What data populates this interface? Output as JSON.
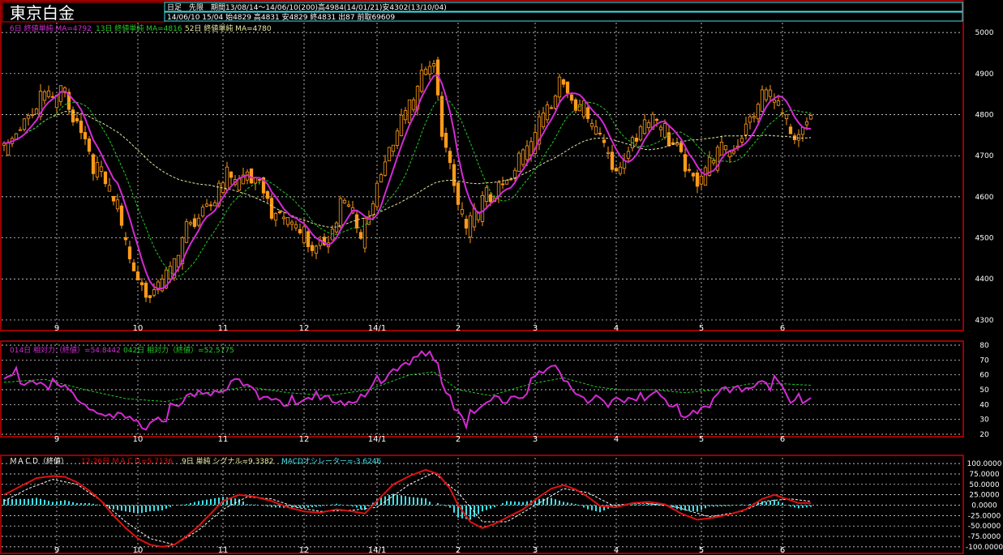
{
  "header": {
    "title": "東京白金",
    "line1": "日足　先限　期間13/08/14～14/06/10(200)高4984(14/01/21)安4302(13/10/04)",
    "line2": "14/06/10 15/04 始4829 高4831 安4829 終4831 出87 前取69609"
  },
  "colors": {
    "up": "#ff9a1a",
    "down": "#ff9a1a",
    "ma6": "#d42ad4",
    "ma13": "#22cc22",
    "ma52": "#e8e8a0",
    "macd": "#e01010",
    "signal": "#ffffff",
    "hist": "#40e0e8",
    "grid": "#ffffff",
    "frame": "#cc0000"
  },
  "chart_data": [
    {
      "type": "candlestick",
      "legend": {
        "ma6": "6日 終値単純 MA=4792",
        "ma13": "13日 終値単純 MA=4816",
        "ma52": "52日 終値単純 MA=4780"
      },
      "yticks": [
        4300,
        4400,
        4500,
        4600,
        4700,
        4800,
        4900,
        5000
      ],
      "ylim": [
        4290,
        5020
      ],
      "xtick_labels": [
        {
          "label": "9",
          "index": 13
        },
        {
          "label": "10",
          "index": 33
        },
        {
          "label": "11",
          "index": 54
        },
        {
          "label": "12",
          "index": 74
        },
        {
          "label": "14/1",
          "index": 92
        },
        {
          "label": "2",
          "index": 112
        },
        {
          "label": "3",
          "index": 131
        },
        {
          "label": "4",
          "index": 151
        },
        {
          "label": "5",
          "index": 172
        },
        {
          "label": "6",
          "index": 192
        }
      ],
      "anchors": [
        [
          0,
          4740
        ],
        [
          4,
          4800
        ],
        [
          7,
          4830
        ],
        [
          10,
          4870
        ],
        [
          12,
          4840
        ],
        [
          15,
          4870
        ],
        [
          17,
          4820
        ],
        [
          20,
          4760
        ],
        [
          22,
          4700
        ],
        [
          25,
          4640
        ],
        [
          28,
          4580
        ],
        [
          30,
          4500
        ],
        [
          33,
          4430
        ],
        [
          36,
          4380
        ],
        [
          38,
          4400
        ],
        [
          41,
          4420
        ],
        [
          43,
          4470
        ],
        [
          46,
          4560
        ],
        [
          49,
          4590
        ],
        [
          52,
          4620
        ],
        [
          55,
          4660
        ],
        [
          58,
          4640
        ],
        [
          61,
          4670
        ],
        [
          64,
          4650
        ],
        [
          66,
          4590
        ],
        [
          68,
          4560
        ],
        [
          71,
          4540
        ],
        [
          74,
          4520
        ],
        [
          77,
          4500
        ],
        [
          80,
          4530
        ],
        [
          83,
          4590
        ],
        [
          86,
          4570
        ],
        [
          88,
          4500
        ],
        [
          90,
          4590
        ],
        [
          92,
          4650
        ],
        [
          95,
          4740
        ],
        [
          98,
          4800
        ],
        [
          101,
          4850
        ],
        [
          104,
          4920
        ],
        [
          106,
          4950
        ],
        [
          108,
          4790
        ],
        [
          110,
          4700
        ],
        [
          112,
          4610
        ],
        [
          114,
          4520
        ],
        [
          116,
          4560
        ],
        [
          119,
          4610
        ],
        [
          122,
          4650
        ],
        [
          125,
          4670
        ],
        [
          128,
          4720
        ],
        [
          131,
          4760
        ],
        [
          134,
          4830
        ],
        [
          137,
          4920
        ],
        [
          140,
          4870
        ],
        [
          143,
          4820
        ],
        [
          146,
          4770
        ],
        [
          149,
          4720
        ],
        [
          151,
          4680
        ],
        [
          154,
          4750
        ],
        [
          157,
          4780
        ],
        [
          160,
          4800
        ],
        [
          163,
          4770
        ],
        [
          166,
          4750
        ],
        [
          169,
          4680
        ],
        [
          172,
          4660
        ],
        [
          175,
          4700
        ],
        [
          178,
          4730
        ],
        [
          181,
          4760
        ],
        [
          184,
          4820
        ],
        [
          187,
          4860
        ],
        [
          190,
          4850
        ],
        [
          192,
          4800
        ],
        [
          195,
          4760
        ],
        [
          197,
          4790
        ],
        [
          199,
          4831
        ]
      ],
      "count": 200
    },
    {
      "type": "line",
      "legend": {
        "rsi14": "014日 相対力（終値）=54.8442",
        "rsi42": "042日 相対力（終値）=52.5775"
      },
      "yticks": [
        20,
        30,
        40,
        50,
        60,
        70,
        80
      ],
      "ylim": [
        20,
        80
      ],
      "anchors": [
        [
          0,
          60
        ],
        [
          3,
          63
        ],
        [
          6,
          60
        ],
        [
          9,
          58
        ],
        [
          12,
          55
        ],
        [
          15,
          52
        ],
        [
          18,
          46
        ],
        [
          21,
          42
        ],
        [
          24,
          38
        ],
        [
          27,
          33
        ],
        [
          30,
          30
        ],
        [
          33,
          28
        ],
        [
          36,
          32
        ],
        [
          39,
          36
        ],
        [
          42,
          40
        ],
        [
          45,
          44
        ],
        [
          48,
          50
        ],
        [
          52,
          54
        ],
        [
          56,
          57
        ],
        [
          60,
          55
        ],
        [
          64,
          50
        ],
        [
          68,
          46
        ],
        [
          72,
          43
        ],
        [
          76,
          45
        ],
        [
          80,
          50
        ],
        [
          84,
          47
        ],
        [
          87,
          42
        ],
        [
          90,
          50
        ],
        [
          93,
          62
        ],
        [
          96,
          70
        ],
        [
          99,
          72
        ],
        [
          102,
          72
        ],
        [
          105,
          76
        ],
        [
          108,
          62
        ],
        [
          111,
          45
        ],
        [
          114,
          33
        ],
        [
          117,
          38
        ],
        [
          120,
          45
        ],
        [
          124,
          48
        ],
        [
          128,
          52
        ],
        [
          131,
          60
        ],
        [
          134,
          66
        ],
        [
          137,
          64
        ],
        [
          140,
          58
        ],
        [
          143,
          50
        ],
        [
          146,
          44
        ],
        [
          149,
          38
        ],
        [
          151,
          42
        ],
        [
          154,
          50
        ],
        [
          157,
          52
        ],
        [
          160,
          48
        ],
        [
          164,
          42
        ],
        [
          168,
          38
        ],
        [
          172,
          42
        ],
        [
          176,
          48
        ],
        [
          180,
          52
        ],
        [
          184,
          58
        ],
        [
          188,
          60
        ],
        [
          191,
          56
        ],
        [
          194,
          44
        ],
        [
          197,
          48
        ],
        [
          199,
          52
        ]
      ],
      "rsi42_anchors": [
        [
          0,
          55
        ],
        [
          10,
          57
        ],
        [
          20,
          50
        ],
        [
          30,
          44
        ],
        [
          40,
          42
        ],
        [
          50,
          48
        ],
        [
          60,
          52
        ],
        [
          70,
          48
        ],
        [
          80,
          46
        ],
        [
          90,
          50
        ],
        [
          100,
          60
        ],
        [
          106,
          62
        ],
        [
          112,
          50
        ],
        [
          120,
          46
        ],
        [
          130,
          54
        ],
        [
          138,
          58
        ],
        [
          146,
          52
        ],
        [
          152,
          50
        ],
        [
          160,
          50
        ],
        [
          168,
          48
        ],
        [
          176,
          50
        ],
        [
          184,
          54
        ],
        [
          192,
          54
        ],
        [
          199,
          53
        ]
      ],
      "count": 200
    },
    {
      "type": "line",
      "legend": {
        "macd": "12-26日 ＭＡＣＤ=5.7136",
        "signal": "9日 単純 シグナル=9.3382",
        "osc": "MACDオシレーター=-3.6246",
        "name": "ＭＡＣＤ（終値）"
      },
      "yticks": [
        100,
        75,
        50,
        25,
        0,
        -25,
        -50,
        -75,
        -100
      ],
      "ytick_labels": [
        "100.0000",
        "75.0000",
        "50.0000",
        "25.0000",
        "0.0000",
        "-25.0000",
        "-50.0000",
        "-75.0000",
        "-100.0000"
      ],
      "ylim": [
        -110,
        110
      ],
      "anchors": [
        [
          0,
          25
        ],
        [
          4,
          45
        ],
        [
          8,
          65
        ],
        [
          12,
          70
        ],
        [
          15,
          68
        ],
        [
          18,
          55
        ],
        [
          21,
          35
        ],
        [
          24,
          10
        ],
        [
          27,
          -25
        ],
        [
          30,
          -55
        ],
        [
          33,
          -80
        ],
        [
          36,
          -95
        ],
        [
          39,
          -100
        ],
        [
          42,
          -95
        ],
        [
          45,
          -75
        ],
        [
          48,
          -50
        ],
        [
          51,
          -20
        ],
        [
          54,
          10
        ],
        [
          58,
          25
        ],
        [
          62,
          20
        ],
        [
          66,
          10
        ],
        [
          70,
          -5
        ],
        [
          74,
          -15
        ],
        [
          78,
          -18
        ],
        [
          82,
          -10
        ],
        [
          86,
          -15
        ],
        [
          89,
          -20
        ],
        [
          92,
          10
        ],
        [
          96,
          50
        ],
        [
          100,
          70
        ],
        [
          104,
          85
        ],
        [
          107,
          75
        ],
        [
          110,
          40
        ],
        [
          112,
          0
        ],
        [
          115,
          -40
        ],
        [
          118,
          -55
        ],
        [
          121,
          -45
        ],
        [
          124,
          -30
        ],
        [
          128,
          -10
        ],
        [
          132,
          20
        ],
        [
          135,
          40
        ],
        [
          138,
          48
        ],
        [
          141,
          38
        ],
        [
          144,
          20
        ],
        [
          147,
          -2
        ],
        [
          151,
          -5
        ],
        [
          155,
          5
        ],
        [
          159,
          8
        ],
        [
          163,
          2
        ],
        [
          167,
          -20
        ],
        [
          171,
          -35
        ],
        [
          175,
          -30
        ],
        [
          179,
          -22
        ],
        [
          183,
          -10
        ],
        [
          187,
          15
        ],
        [
          190,
          25
        ],
        [
          193,
          15
        ],
        [
          196,
          5
        ],
        [
          199,
          5
        ]
      ],
      "signal_anchors": [
        [
          0,
          10
        ],
        [
          6,
          40
        ],
        [
          12,
          62
        ],
        [
          18,
          50
        ],
        [
          24,
          10
        ],
        [
          30,
          -40
        ],
        [
          36,
          -80
        ],
        [
          42,
          -95
        ],
        [
          48,
          -60
        ],
        [
          54,
          -10
        ],
        [
          60,
          20
        ],
        [
          66,
          15
        ],
        [
          72,
          -5
        ],
        [
          78,
          -15
        ],
        [
          86,
          -12
        ],
        [
          92,
          -5
        ],
        [
          100,
          50
        ],
        [
          106,
          78
        ],
        [
          112,
          30
        ],
        [
          118,
          -40
        ],
        [
          124,
          -40
        ],
        [
          132,
          5
        ],
        [
          138,
          40
        ],
        [
          144,
          30
        ],
        [
          150,
          0
        ],
        [
          158,
          5
        ],
        [
          166,
          -5
        ],
        [
          174,
          -28
        ],
        [
          182,
          -15
        ],
        [
          188,
          10
        ],
        [
          194,
          15
        ],
        [
          199,
          9
        ]
      ],
      "count": 200
    }
  ]
}
